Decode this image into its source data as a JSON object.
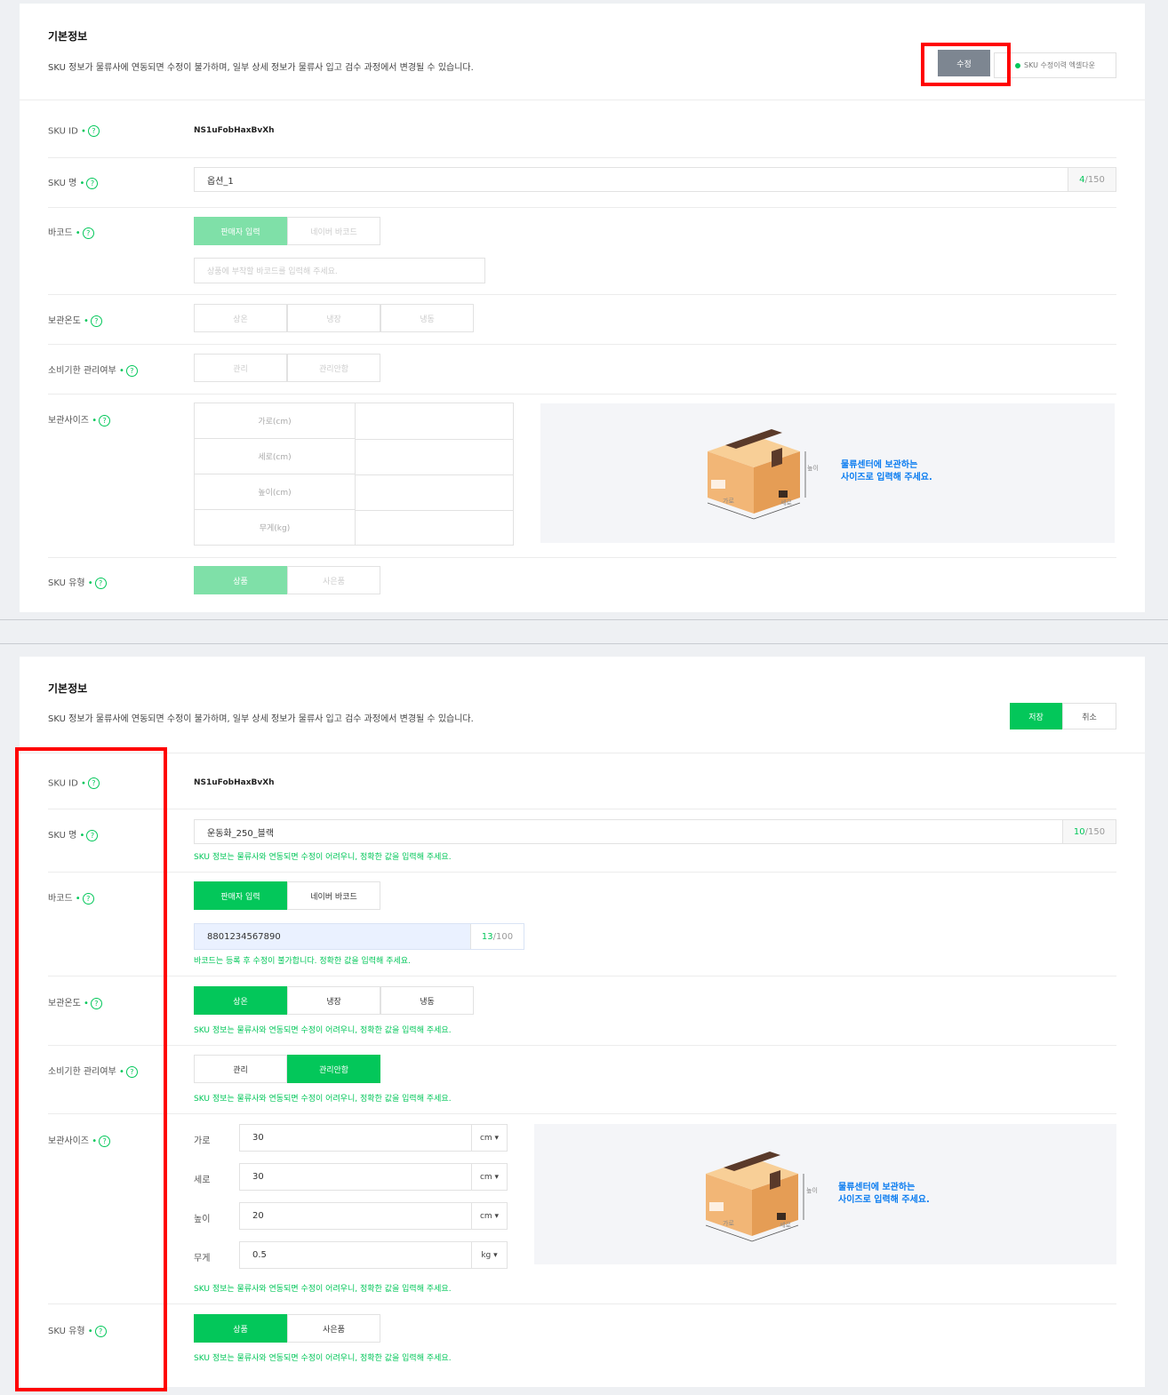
{
  "top": {
    "section_title": "기본정보",
    "description": "SKU 정보가 물류사에 연동되면 수정이 불가하며, 일부 상세 정보가 물류사 입고 검수 과정에서 변경될 수 있습니다.",
    "edit_button": "수정",
    "excel_download": "SKU 수정이력 엑셀다운",
    "sku_id_label": "SKU ID",
    "sku_id_value": "NS1uFobHaxBvXh",
    "sku_name_label": "SKU 명",
    "sku_name_value": "옵션_1",
    "sku_name_count": "4",
    "sku_name_max": "/150",
    "barcode_label": "바코드",
    "barcode_tab_seller": "판매자 입력",
    "barcode_tab_naver": "네이버 바코드",
    "barcode_placeholder": "상품에 부착할 바코드를 입력해 주세요.",
    "temp_label": "보관온도",
    "temp_options": [
      "상온",
      "냉장",
      "냉동"
    ],
    "expiry_label": "소비기한 관리여부",
    "expiry_options": [
      "관리",
      "관리안함"
    ],
    "size_label": "보관사이즈",
    "size_rows": [
      "가로(cm)",
      "세로(cm)",
      "높이(cm)",
      "무게(kg)"
    ],
    "type_label": "SKU 유형",
    "type_options": [
      "상품",
      "사은품"
    ]
  },
  "bottom": {
    "section_title": "기본정보",
    "description": "SKU 정보가 물류사에 연동되면 수정이 불가하며, 일부 상세 정보가 물류사 입고 검수 과정에서 변경될 수 있습니다.",
    "save_button": "저장",
    "cancel_button": "취소",
    "sku_id_label": "SKU ID",
    "sku_id_value": "NS1uFobHaxBvXh",
    "sku_name_label": "SKU 명",
    "sku_name_value": "운동화_250_블랙",
    "sku_name_count": "10",
    "sku_name_max": "/150",
    "hint_general": "SKU 정보는 물류사와 연동되면 수정이 어려우니, 정확한 값을 입력해 주세요.",
    "barcode_label": "바코드",
    "barcode_tab_seller": "판매자 입력",
    "barcode_tab_naver": "네이버 바코드",
    "barcode_value": "8801234567890",
    "barcode_count": "13",
    "barcode_max": "/100",
    "barcode_hint": "바코드는 등록 후 수정이 불가합니다. 정확한 값을 입력해 주세요.",
    "temp_label": "보관온도",
    "temp_options": [
      "상온",
      "냉장",
      "냉동"
    ],
    "expiry_label": "소비기한 관리여부",
    "expiry_options": [
      "관리",
      "관리안함"
    ],
    "size_label": "보관사이즈",
    "size_fields": [
      {
        "label": "가로",
        "value": "30",
        "unit": "cm"
      },
      {
        "label": "세로",
        "value": "30",
        "unit": "cm"
      },
      {
        "label": "높이",
        "value": "20",
        "unit": "cm"
      },
      {
        "label": "무게",
        "value": "0.5",
        "unit": "kg"
      }
    ],
    "type_label": "SKU 유형",
    "type_options": [
      "상품",
      "사은품"
    ]
  },
  "illustration": {
    "text_line1": "물류센터에 보관하는",
    "text_line2": "사이즈로 입력해 주세요.",
    "dim_width": "가로",
    "dim_depth": "세로",
    "dim_height": "높이"
  },
  "colors": {
    "accent_green": "#03c75a",
    "highlight_red": "#ff0000",
    "illustration_text": "#0a7cf0",
    "box_cardboard": "#f0b070"
  }
}
